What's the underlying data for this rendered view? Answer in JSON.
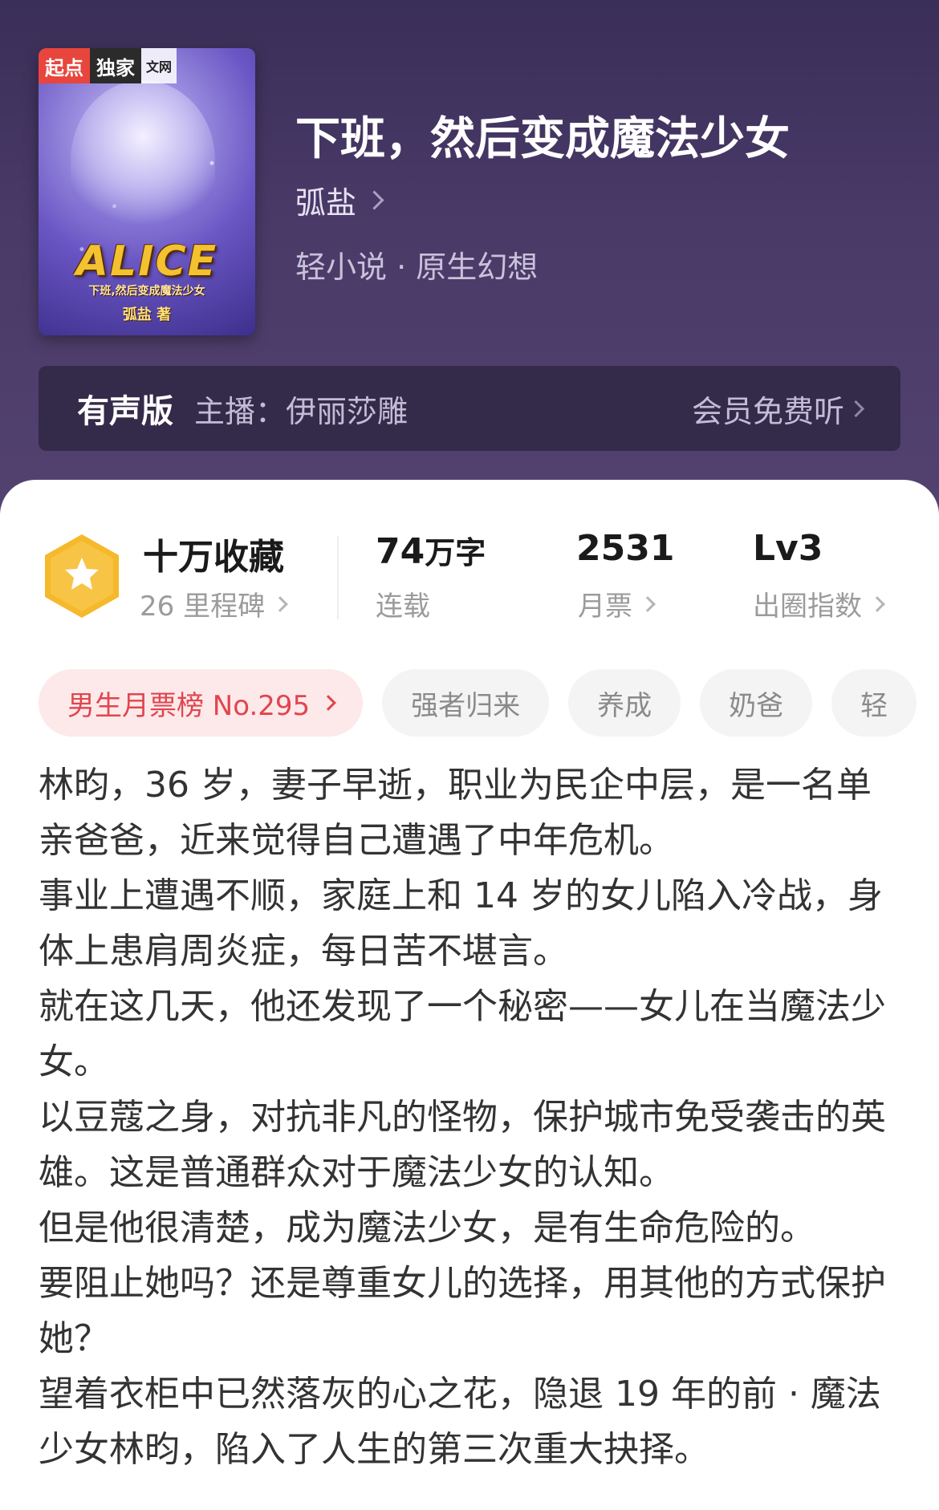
{
  "book": {
    "cover": {
      "badge_qidian": "起点",
      "badge_exclusive": "独家",
      "badge_site": "文网",
      "title_art": "ALICE",
      "subtitle": "下班,然后变成魔法少女",
      "author": "弧盐 著"
    },
    "title": "下班，然后变成魔法少女",
    "author": "弧盐",
    "genre": "轻小说 · 原生幻想"
  },
  "audio": {
    "label": "有声版",
    "host": "主播：伊丽莎雕",
    "action": "会员免费听"
  },
  "stats": {
    "favorites": "十万收藏",
    "milestones": "26 里程碑",
    "word_count_num": "74",
    "word_count_unit": "万字",
    "status": "连载",
    "monthly_votes": "2531",
    "monthly_votes_label": "月票",
    "level": "Lv3",
    "level_label": "出圈指数"
  },
  "tags": {
    "rank": "男生月票榜 No.295",
    "items": [
      "强者归来",
      "养成",
      "奶爸",
      "轻"
    ]
  },
  "description": [
    "林昀，36 岁，妻子早逝，职业为民企中层，是一名单亲爸爸，近来觉得自己遭遇了中年危机。",
    "事业上遭遇不顺，家庭上和 14 岁的女儿陷入冷战，身体上患肩周炎症，每日苦不堪言。",
    "就在这几天，他还发现了一个秘密——女儿在当魔法少女。",
    "以豆蔻之身，对抗非凡的怪物，保护城市免受袭击的英雄。这是普通群众对于魔法少女的认知。",
    "但是他很清楚，成为魔法少女，是有生命危险的。",
    "要阻止她吗？还是尊重女儿的选择，用其他的方式保护她？",
    "望着衣柜中已然落灰的心之花，隐退 19 年的前 · 魔法少女林昀，陷入了人生的第三次重大抉择。"
  ]
}
